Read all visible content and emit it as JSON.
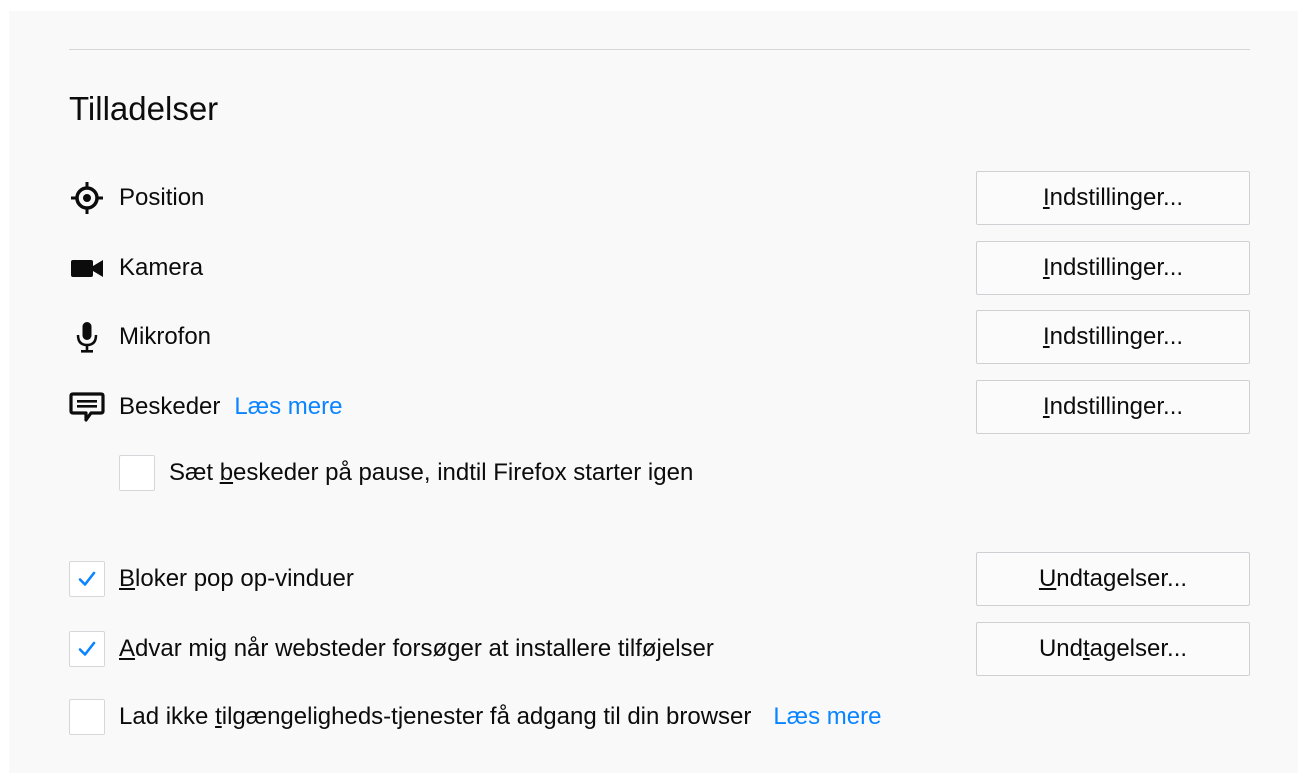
{
  "section": {
    "title": "Tilladelser"
  },
  "permissions": [
    {
      "label": "Position",
      "icon": "location-icon",
      "button": {
        "pre": "",
        "key": "I",
        "post": "ndstillinger..."
      }
    },
    {
      "label": "Kamera",
      "icon": "camera-icon",
      "button": {
        "pre": "",
        "key": "I",
        "post": "ndstillinger..."
      }
    },
    {
      "label": "Mikrofon",
      "icon": "microphone-icon",
      "button": {
        "pre": "",
        "key": "I",
        "post": "ndstillinger..."
      }
    },
    {
      "label": "Beskeder",
      "icon": "chat-bubble-icon",
      "link": "Læs mere",
      "button": {
        "pre": "",
        "key": "I",
        "post": "ndstillinger..."
      }
    }
  ],
  "pause_notifications": {
    "pre": "Sæt ",
    "key": "b",
    "post": "eskeder på pause, indtil Firefox starter igen",
    "checked": false
  },
  "block_popups": {
    "pre": "",
    "key": "B",
    "post": "loker pop op-vinduer",
    "checked": true,
    "button": {
      "pre": "",
      "key": "U",
      "post": "ndtagelser..."
    }
  },
  "warn_addons": {
    "pre": "",
    "key": "A",
    "post": "dvar mig når websteder forsøger at installere tilføjelser",
    "checked": true,
    "button": {
      "pre": "Und",
      "key": "t",
      "post": "agelser..."
    }
  },
  "accessibility": {
    "pre": "Lad ikke ",
    "key": "t",
    "post": "ilgængeligheds-tjenester få adgang til din browser",
    "checked": false,
    "link": "Læs mere"
  },
  "colors": {
    "link": "#0a84ff",
    "check": "#0a84ff",
    "text": "#0c0c0d",
    "background": "#f9f9fa"
  }
}
